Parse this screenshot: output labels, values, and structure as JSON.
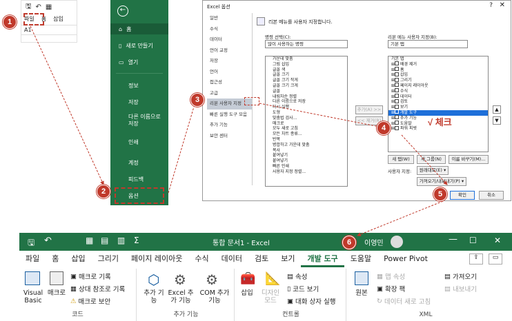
{
  "panel1": {
    "tabs": [
      "파일",
      "홈",
      "삽입"
    ],
    "cell": "A1"
  },
  "panel2": {
    "items": [
      "홈",
      "새로 만들기",
      "열기",
      "정보",
      "저장",
      "다른 이름으로 저장",
      "인쇄",
      "계정",
      "피드백",
      "옵션"
    ]
  },
  "dialog": {
    "title": "Excel 옵션",
    "nav": [
      "일반",
      "수식",
      "데이터",
      "언어 교정",
      "저장",
      "언어",
      "접근성",
      "고급",
      "리본 사용자 지정",
      "빠른 실행 도구 모음",
      "추가 기능",
      "보안 센터"
    ],
    "header": "리본 메뉴를 사용자 지정합니다.",
    "left_label": "명령 선택(C):",
    "left_select": "많이 사용하는 명령",
    "right_label": "리본 메뉴 사용자 지정(B):",
    "right_select": "기본 탭",
    "commands": [
      "가운데 맞춤",
      "그림 삽입",
      "글꼴 색",
      "글꼴 크기",
      "글꼴 크기 작게",
      "글꼴 크기 크게",
      "글꼴",
      "내림차순 정렬",
      "다른 이름으로 저장",
      "다시 실행",
      "도형",
      "맞춤법 검사...",
      "매크로",
      "모두 새로 고침",
      "모든 차트 종류...",
      "반복",
      "병합하고 가운데 맞춤",
      "복사",
      "붙여넣기",
      "붙여넣기",
      "빠른 인쇄",
      "사용자 지정 정렬..."
    ],
    "tree_header": "기본 탭",
    "tree": [
      "배경 제거",
      "홈",
      "삽입",
      "그리기",
      "페이지 레이아웃",
      "수식",
      "데이터",
      "검토",
      "보기",
      "개발 도구",
      "추가 기능",
      "도움말",
      "파워 피벗"
    ],
    "add_btn": "추가(A) >>",
    "remove_btn": "<< 제거(R)",
    "new_tab": "새 탭(W)",
    "new_group": "새 그룹(N)",
    "rename": "이름 바꾸기(M)...",
    "custom_label": "사용자 지정:",
    "reset": "원래대로(E) ▾",
    "import_export": "가져오기/내보내기(P) ▾",
    "ok": "확인",
    "cancel": "취소",
    "annotation": "√ 체크"
  },
  "badges": [
    "1",
    "2",
    "3",
    "4",
    "5",
    "6"
  ],
  "excel": {
    "doc_title": "통합 문서1 - Excel",
    "user": "이영민",
    "tabs": [
      "파일",
      "홈",
      "삽입",
      "그리기",
      "페이지 레이아웃",
      "수식",
      "데이터",
      "검토",
      "보기",
      "개발 도구",
      "도움말",
      "Power Pivot"
    ],
    "code": {
      "vb": "Visual Basic",
      "macro": "매크로",
      "record": "매크로 기록",
      "relative": "상대 참조로 기록",
      "security": "매크로 보안",
      "label": "코드"
    },
    "addins": {
      "addin": "추가 기능",
      "excel_addin": "Excel 추가 기능",
      "com_addin": "COM 추가 기능",
      "label": "추가 기능"
    },
    "controls": {
      "insert": "삽입",
      "design": "디자인 모드",
      "props": "속성",
      "view_code": "코드 보기",
      "dialog": "대화 상자 실행",
      "label": "컨트롤"
    },
    "xml": {
      "source": "원본",
      "map_props": "맵 속성",
      "expansion": "확장 팩",
      "refresh": "데이터 새로 고침",
      "import": "가져오기",
      "export": "내보내기",
      "label": "XML"
    }
  },
  "colors": {
    "excel_green": "#217346",
    "badge_red": "#c0392b",
    "arrow_red": "#c0392b",
    "select_blue": "#1e6fd9"
  }
}
